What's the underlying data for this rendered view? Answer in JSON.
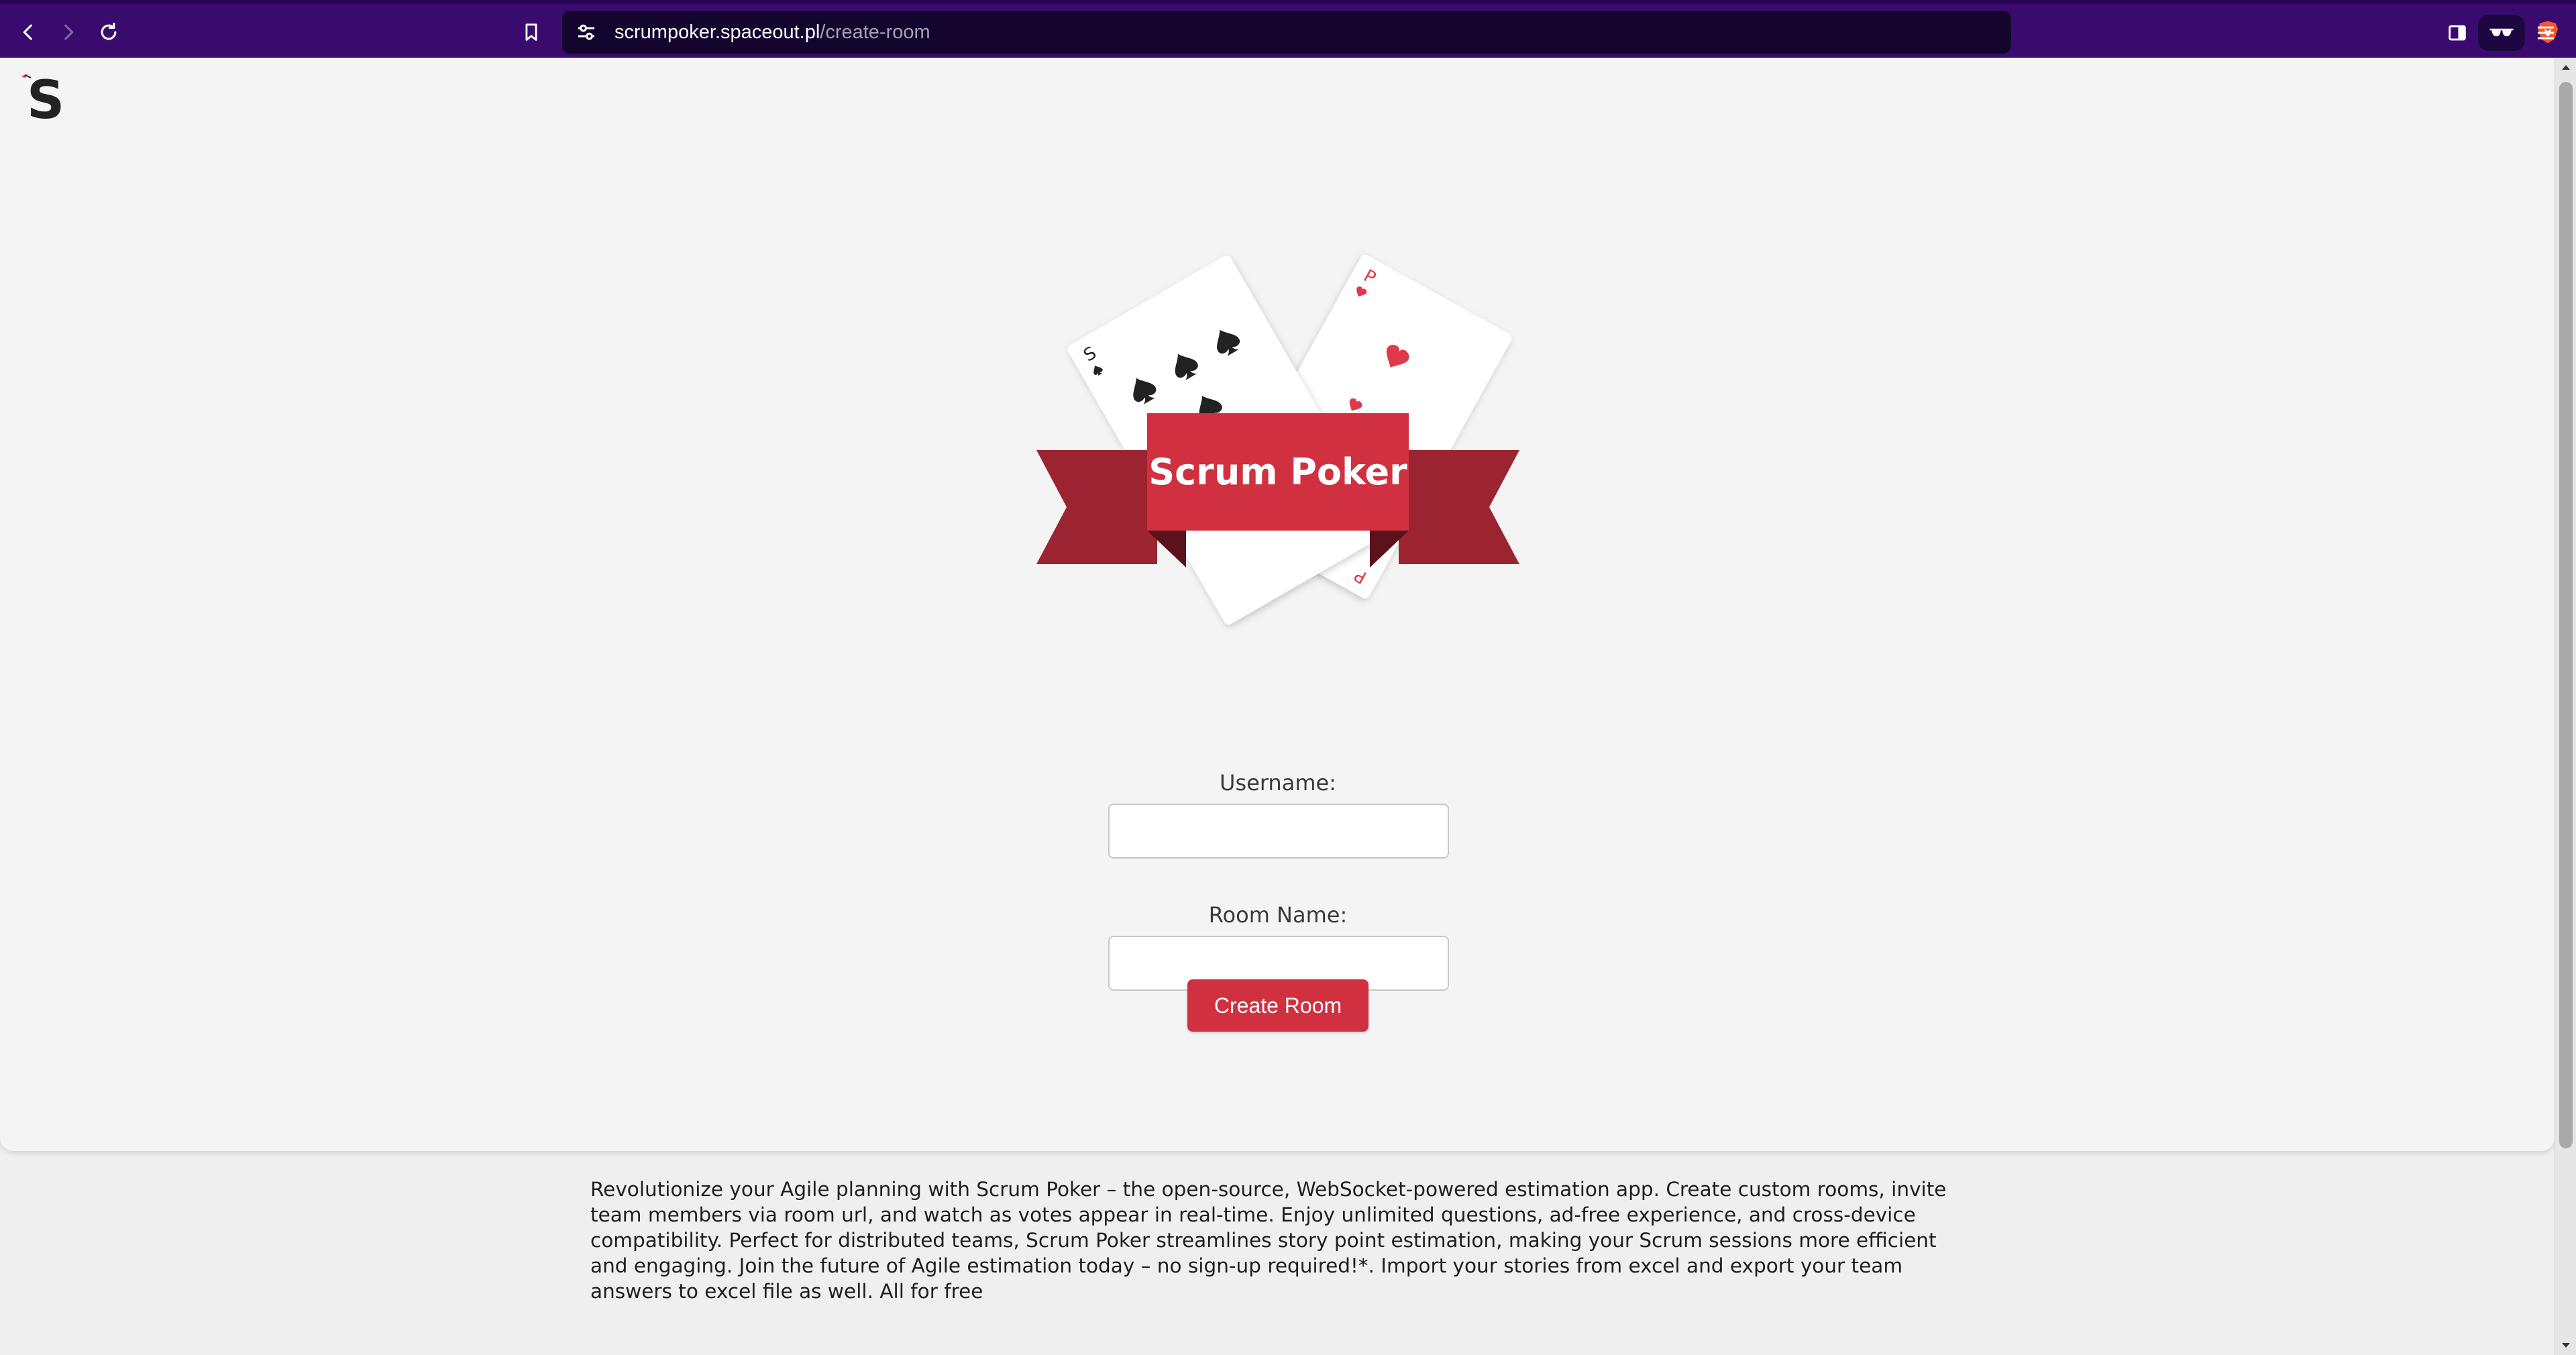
{
  "browser": {
    "url_host": "scrumpoker.spaceout.pl",
    "url_path": "/create-room",
    "icons": {
      "back": "back-arrow-icon",
      "forward": "forward-arrow-icon",
      "reload": "reload-icon",
      "bookmark": "bookmark-icon",
      "site_info": "site-info-icon",
      "shield": "brave-shield-icon",
      "sidebar": "sidebar-icon",
      "private": "private-glasses-icon",
      "menu": "hamburger-menu-icon"
    }
  },
  "logo": {
    "letter": "S"
  },
  "hero": {
    "title": "Scrum Poker",
    "card_left_corner": "S",
    "card_right_corner": "P"
  },
  "form": {
    "username_label": "Username:",
    "username_value": "",
    "room_label": "Room Name:",
    "room_value": "",
    "submit_label": "Create Room"
  },
  "description": "Revolutionize your Agile planning with Scrum Poker – the open-source, WebSocket-powered estimation app. Create custom rooms, invite team members via room url, and watch as votes appear in real-time. Enjoy unlimited questions, ad-free experience, and cross-device compatibility. Perfect for distributed teams, Scrum Poker streamlines story point estimation, making your Scrum sessions more efficient and engaging. Join the future of Agile estimation today – no sign-up required!*. Import your stories from excel and export your team answers to excel file as well. All for free",
  "colors": {
    "accent": "#d03040",
    "ribbon_dark": "#9b2430",
    "chrome": "#3a0a6e",
    "urlbar": "#14052e",
    "heart": "#e03a4a",
    "spade": "#222222"
  }
}
